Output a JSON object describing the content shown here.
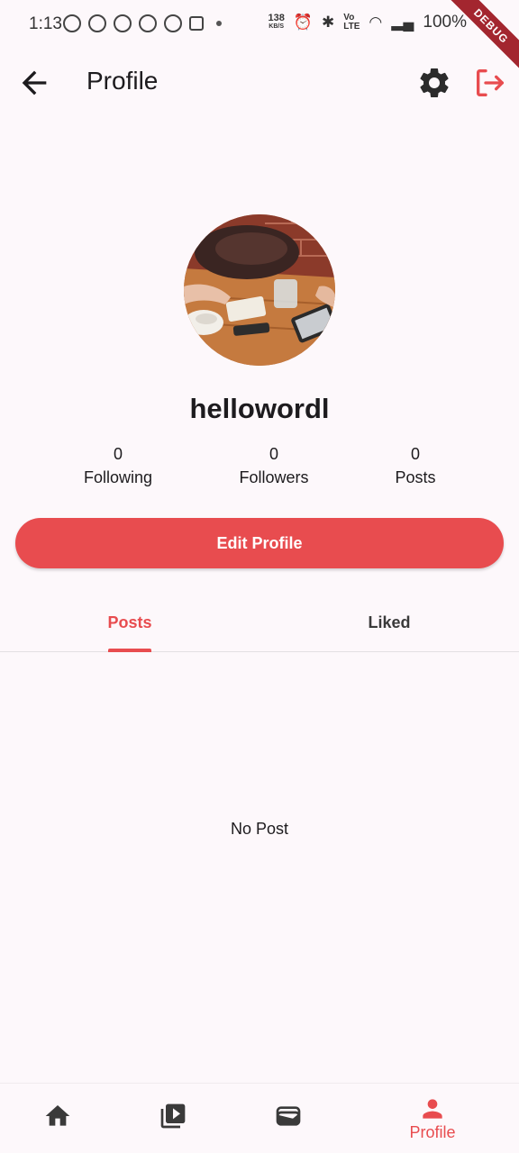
{
  "status_bar": {
    "time": "1:13",
    "net_speed": "138",
    "net_unit": "KB/S",
    "battery": "100%",
    "debug_label": "DEBUG"
  },
  "app_bar": {
    "title": "Profile",
    "back_icon": "arrow-back-icon",
    "settings_icon": "gear-icon",
    "logout_icon": "logout-icon"
  },
  "profile": {
    "username": "hellowordl",
    "stats": [
      {
        "value": "0",
        "label": "Following"
      },
      {
        "value": "0",
        "label": "Followers"
      },
      {
        "value": "0",
        "label": "Posts"
      }
    ],
    "edit_button_label": "Edit Profile"
  },
  "tabs": [
    {
      "label": "Posts",
      "selected": true
    },
    {
      "label": "Liked",
      "selected": false
    }
  ],
  "empty_message": "No Post",
  "bottom_nav": {
    "items": [
      {
        "icon": "home-icon",
        "label": ""
      },
      {
        "icon": "video-library-icon",
        "label": ""
      },
      {
        "icon": "wallet-icon",
        "label": ""
      },
      {
        "icon": "person-icon",
        "label": "Profile",
        "selected": true
      }
    ]
  },
  "colors": {
    "accent": "#e84c4f",
    "background": "#fdf8fb",
    "text": "#1d1b1e"
  }
}
